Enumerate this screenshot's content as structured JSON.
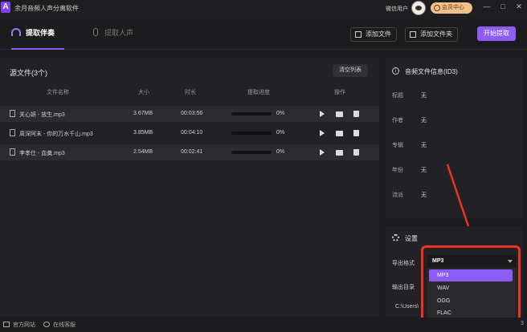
{
  "app": {
    "logo": "A",
    "title": "余月音频人声分离软件"
  },
  "titlebar": {
    "user_name": "微信用户",
    "vip_label": "会员中心",
    "window_controls": [
      "—",
      "□",
      "✕"
    ]
  },
  "tabs": [
    {
      "label": "提取伴奏",
      "icon": "headphones-icon",
      "active": true
    },
    {
      "label": "提取人声",
      "icon": "microphone-icon",
      "active": false
    }
  ],
  "toolbar": {
    "add_file": "添加文件",
    "add_folder": "添加文件夹",
    "start": "开始提取"
  },
  "file_panel": {
    "title": "源文件(3个)",
    "clear_label": "清空列表",
    "columns": [
      "文件名称",
      "大小",
      "时长",
      "提取进度",
      "操作"
    ],
    "rows": [
      {
        "name": "关心妍 - 放生.mp3",
        "size": "3.67MB",
        "duration": "00:03:56",
        "progress": "0%",
        "progress_value": 0
      },
      {
        "name": "周深阿末 - 你的万水千山.mp3",
        "size": "3.85MB",
        "duration": "00:04:10",
        "progress": "0%",
        "progress_value": 0
      },
      {
        "name": "李孝仕 - 血奠.mp3",
        "size": "2.54MB",
        "duration": "00:02:41",
        "progress": "0%",
        "progress_value": 0
      }
    ]
  },
  "info_panel": {
    "title": "音频文件信息(ID3)",
    "fields": [
      {
        "label": "标题",
        "value": "无"
      },
      {
        "label": "作者",
        "value": "无"
      },
      {
        "label": "专辑",
        "value": "无"
      },
      {
        "label": "年份",
        "value": "无"
      },
      {
        "label": "流派",
        "value": "无"
      }
    ]
  },
  "settings": {
    "title": "设置",
    "format_label": "导出格式",
    "output_label": "输出目录",
    "selected_format": "MP3",
    "format_options": [
      "MP3",
      "WAV",
      "OGG",
      "FLAC"
    ],
    "path": "C:\\Users\\"
  },
  "footer": {
    "website": "官方网站",
    "support": "在线客服",
    "version": "3"
  },
  "colors": {
    "accent": "#8b5cf6",
    "highlight": "#ee3322",
    "background": "#1c1c1f",
    "panel": "#222226"
  }
}
